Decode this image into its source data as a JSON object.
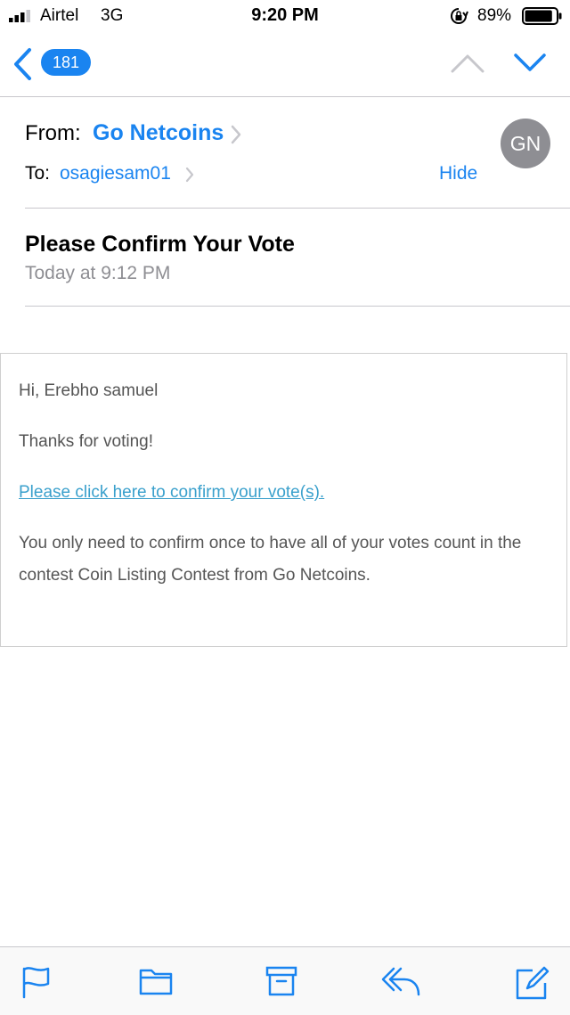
{
  "status_bar": {
    "carrier": "Airtel",
    "network": "3G",
    "time": "9:20 PM",
    "battery_percent": "89%",
    "battery_level": 0.89
  },
  "nav": {
    "back_count": "181"
  },
  "header": {
    "from_label": "From:",
    "from_name": "Go Netcoins",
    "to_label": "To:",
    "to_name": "osagiesam01",
    "hide_label": "Hide",
    "avatar_initials": "GN",
    "subject": "Please Confirm Your Vote",
    "date": "Today at 9:12 PM"
  },
  "body": {
    "greeting": "Hi, Erebho samuel",
    "thanks": "Thanks for voting!",
    "confirm_link": "Please click here to confirm your vote(s).",
    "note": "You only need to confirm once to have all of your votes count in the contest Coin Listing Contest from Go Netcoins."
  },
  "toolbar": {
    "icons": [
      "flag-icon",
      "folder-icon",
      "archive-icon",
      "reply-icon",
      "compose-icon"
    ]
  },
  "colors": {
    "accent": "#1a84f0",
    "link": "#3aa0cc",
    "secondary_text": "#8e8e93"
  }
}
